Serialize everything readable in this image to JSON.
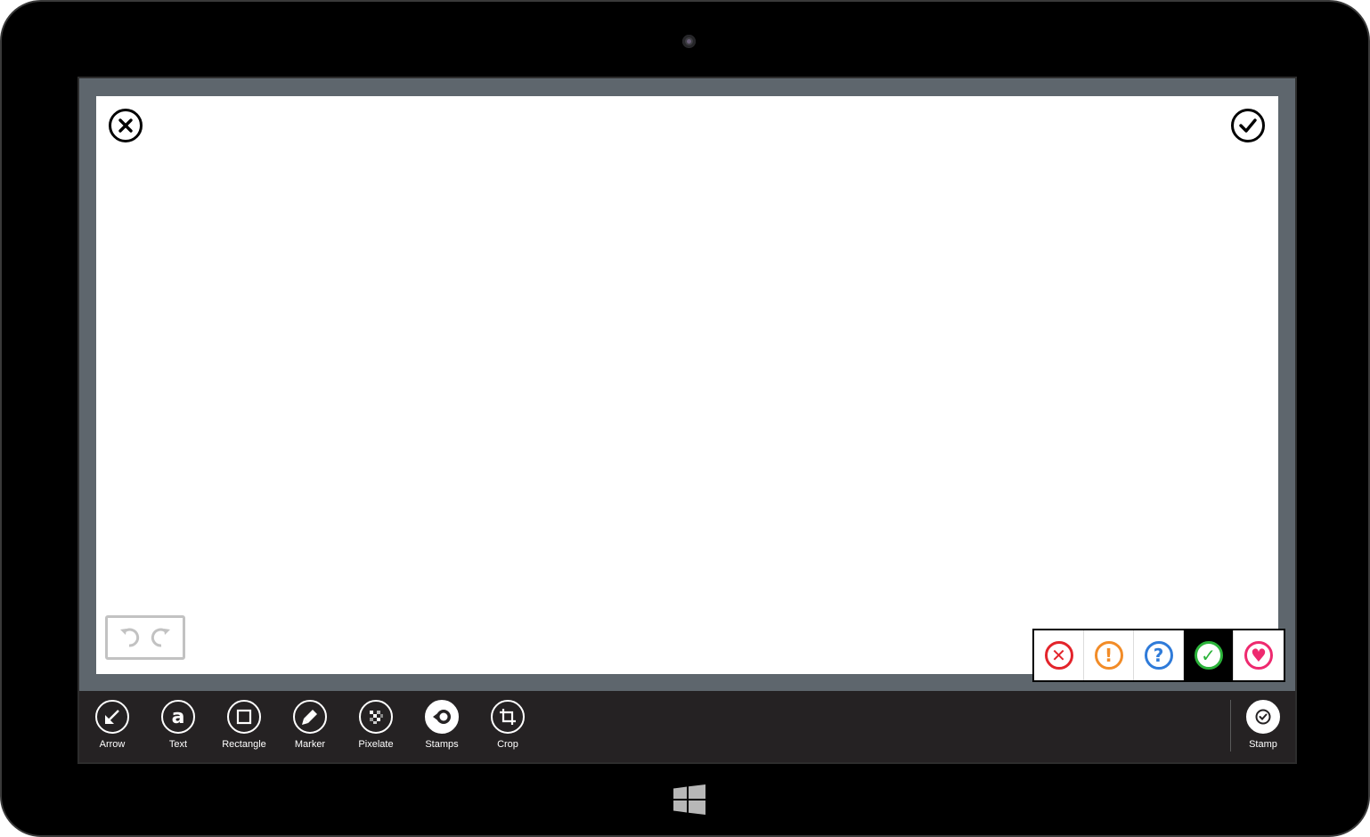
{
  "toolbar": {
    "tools": [
      {
        "label": "Arrow",
        "icon": "arrow-icon"
      },
      {
        "label": "Text",
        "icon": "text-a-icon"
      },
      {
        "label": "Rectangle",
        "icon": "rectangle-icon"
      },
      {
        "label": "Marker",
        "icon": "marker-icon"
      },
      {
        "label": "Pixelate",
        "icon": "pixelate-icon"
      },
      {
        "label": "Stamps",
        "icon": "stamps-icon"
      },
      {
        "label": "Crop",
        "icon": "crop-icon"
      }
    ],
    "stamp_label": "Stamp"
  },
  "stamp_options": [
    {
      "name": "error",
      "symbol": "✕",
      "color": "#e3242b"
    },
    {
      "name": "warning",
      "symbol": "!",
      "color": "#f28c28"
    },
    {
      "name": "question",
      "symbol": "?",
      "color": "#2f7bd9"
    },
    {
      "name": "check",
      "symbol": "✓",
      "color": "#2bb33a",
      "selected": true
    },
    {
      "name": "heart",
      "symbol": "♥",
      "color": "#ee2a6f"
    }
  ],
  "colors": {
    "bezel": "#000000",
    "screen_background": "#5e666d",
    "app_bar": "#252223"
  }
}
